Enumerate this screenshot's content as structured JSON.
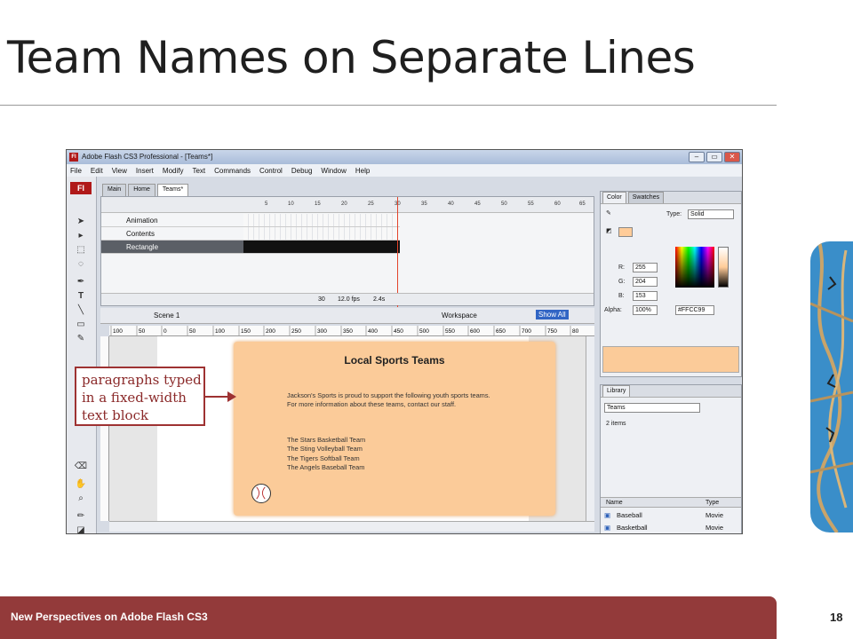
{
  "slide": {
    "title": "Team Names on Separate Lines",
    "footer": "New Perspectives on Adobe Flash CS3",
    "page_number": "18"
  },
  "callout": {
    "text": "paragraphs typed\nin a fixed-width\ntext block"
  },
  "window": {
    "title": "Adobe Flash CS3 Professional - [Teams*]",
    "logo": "Fl",
    "buttons": {
      "minimize": "–",
      "restore": "▭",
      "close": "✕"
    },
    "menu": [
      "File",
      "Edit",
      "View",
      "Insert",
      "Modify",
      "Text",
      "Commands",
      "Control",
      "Debug",
      "Window",
      "Help"
    ],
    "doc_tabs": [
      "Main",
      "Home",
      "Teams*"
    ],
    "timeline": {
      "frame_numbers": [
        "5",
        "10",
        "15",
        "20",
        "25",
        "30",
        "35",
        "40",
        "45",
        "50",
        "55",
        "60",
        "65"
      ],
      "layers": [
        "Animation",
        "Contents",
        "Rectangle"
      ],
      "footer": {
        "frame": "30",
        "fps": "12.0 fps",
        "time": "2.4s"
      }
    },
    "scene": {
      "name": "Scene 1",
      "workspace": "Workspace",
      "zoom": "Show All"
    },
    "ruler_labels": [
      "100",
      "50",
      "0",
      "50",
      "100",
      "150",
      "200",
      "250",
      "300",
      "350",
      "400",
      "450",
      "500",
      "550",
      "600",
      "650",
      "700",
      "750",
      "80"
    ],
    "stage": {
      "heading": "Local Sports Teams",
      "paragraph": "Jackson's Sports is proud to support the following youth sports teams. For more information about these teams, contact our staff.",
      "teams": [
        "The Stars Basketball Team",
        "The Sting Volleyball Team",
        "The Tigers Softball Team",
        "The Angels Baseball Team"
      ]
    },
    "color_panel": {
      "tabs": [
        "Color",
        "Swatches"
      ],
      "type_label": "Type:",
      "type_value": "Solid",
      "r_label": "R:",
      "r": "255",
      "g_label": "G:",
      "g": "204",
      "b_label": "B:",
      "b": "153",
      "alpha_label": "Alpha:",
      "alpha": "100%",
      "hex": "#FFCC99",
      "fill_color": "#ffcc99"
    },
    "library_panel": {
      "tab": "Library",
      "doc": "Teams",
      "count": "2 items",
      "col_name": "Name",
      "col_type": "Type",
      "items": [
        {
          "name": "Baseball",
          "type": "Movie"
        },
        {
          "name": "Basketball",
          "type": "Movie"
        }
      ]
    }
  }
}
